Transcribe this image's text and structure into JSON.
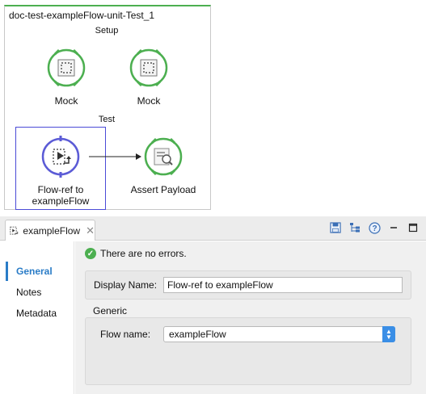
{
  "canvas": {
    "flow_title": "doc-test-exampleFlow-unit-Test_1",
    "setup_label": "Setup",
    "test_label": "Test",
    "nodes": [
      {
        "label": "Mock",
        "icon": "mock-icon"
      },
      {
        "label": "Mock",
        "icon": "mock-icon"
      },
      {
        "label": "Flow-ref to exampleFlow",
        "icon": "flow-ref-icon"
      },
      {
        "label": "Assert Payload",
        "icon": "assert-icon"
      }
    ],
    "colors": {
      "green": "#4caf50",
      "blue": "#5b5bd6"
    }
  },
  "panel": {
    "tab_label": "exampleFlow",
    "toolbar": [
      "save-icon",
      "tree-icon",
      "help-icon",
      "minimize-icon",
      "maximize-icon"
    ],
    "nav": [
      "General",
      "Notes",
      "Metadata"
    ],
    "active_nav": "General",
    "status_text": "There are no errors.",
    "display_name_label": "Display Name:",
    "display_name_value": "Flow-ref to exampleFlow",
    "generic_label": "Generic",
    "flow_name_label": "Flow name:",
    "flow_name_value": "exampleFlow"
  }
}
